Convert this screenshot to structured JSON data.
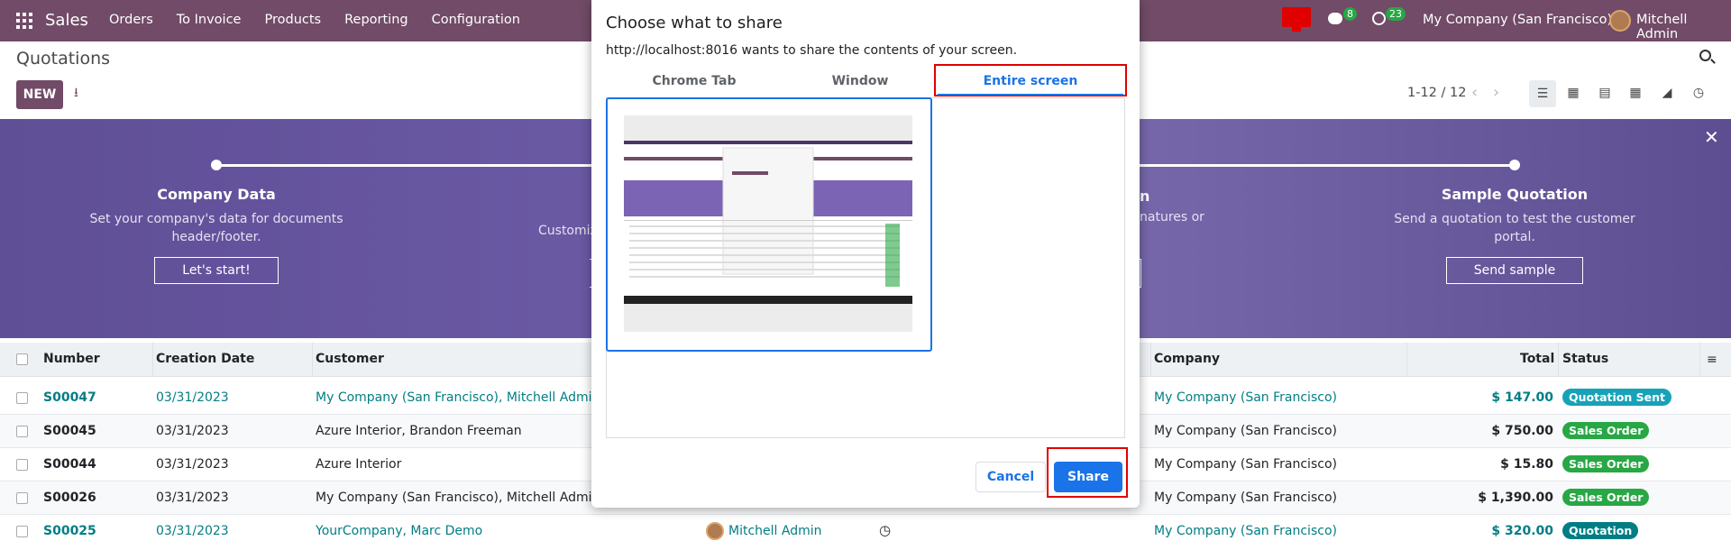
{
  "navbar": {
    "brand": "Sales",
    "menu": [
      "Orders",
      "To Invoice",
      "Products",
      "Reporting",
      "Configuration"
    ],
    "chat_count": "8",
    "activity_count": "23",
    "company": "My Company (San Francisco)",
    "user": "Mitchell Admin"
  },
  "control": {
    "title": "Quotations",
    "new_label": "NEW",
    "pager": "1-12 / 12"
  },
  "banner": {
    "steps": [
      {
        "title": "Company Data",
        "text": "Set your company's data for documents header/footer.",
        "button": "Let's start!"
      },
      {
        "title": "Sample Quotation",
        "text": "Send a quotation to test the customer portal.",
        "button": "Send sample"
      }
    ],
    "fragments": {
      "left_text": "Customiz",
      "right_head": "n",
      "right_text": "natures or"
    }
  },
  "table": {
    "headers": {
      "number": "Number",
      "creation_date": "Creation Date",
      "customer": "Customer",
      "company": "Company",
      "total": "Total",
      "status": "Status"
    },
    "rows": [
      {
        "number": "S00047",
        "date": "03/31/2023",
        "customer": "My Company (San Francisco), Mitchell Admin",
        "company": "My Company (San Francisco)",
        "total": "$ 147.00",
        "status": "Quotation Sent",
        "linked": true
      },
      {
        "number": "S00045",
        "date": "03/31/2023",
        "customer": "Azure Interior, Brandon Freeman",
        "company": "My Company (San Francisco)",
        "total": "$ 750.00",
        "status": "Sales Order",
        "linked": false
      },
      {
        "number": "S00044",
        "date": "03/31/2023",
        "customer": "Azure Interior",
        "company": "My Company (San Francisco)",
        "total": "$ 15.80",
        "status": "Sales Order",
        "linked": false
      },
      {
        "number": "S00026",
        "date": "03/31/2023",
        "customer": "My Company (San Francisco), Mitchell Admin",
        "company": "My Company (San Francisco)",
        "total": "$ 1,390.00",
        "status": "Sales Order",
        "linked": false
      },
      {
        "number": "S00025",
        "date": "03/31/2023",
        "customer": "YourCompany, Marc Demo",
        "company": "My Company (San Francisco)",
        "total": "$ 320.00",
        "status": "Quotation",
        "linked": true,
        "salesperson": "Mitchell Admin"
      }
    ]
  },
  "dialog": {
    "title": "Choose what to share",
    "subtitle": "http://localhost:8016 wants to share the contents of your screen.",
    "tabs": [
      "Chrome Tab",
      "Window",
      "Entire screen"
    ],
    "cancel": "Cancel",
    "share": "Share"
  },
  "colors": {
    "brand": "#714b67",
    "link": "#017e84",
    "status_sent": "#17a2b8",
    "status_order": "#28a745",
    "chrome_blue": "#1a73e8",
    "highlight_red": "#e00000"
  }
}
